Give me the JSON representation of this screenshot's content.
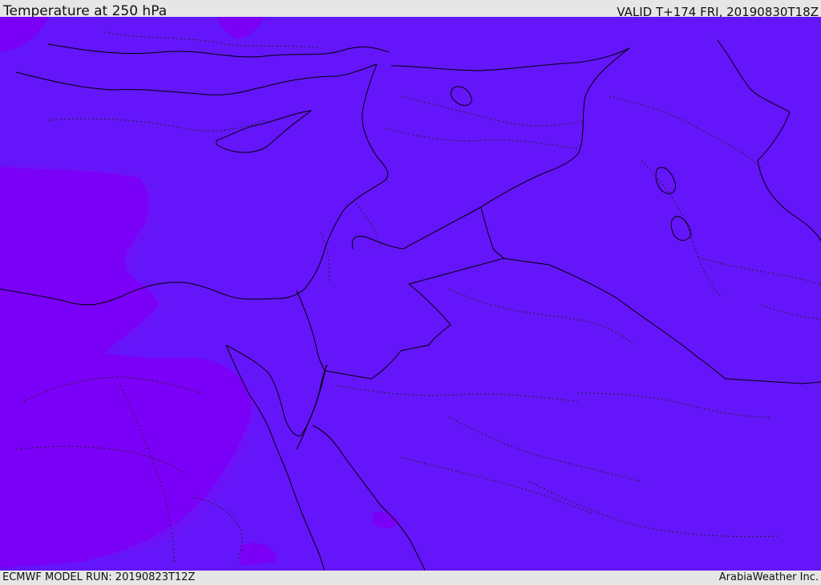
{
  "header": {
    "title": "Temperature at 250 hPa",
    "valid": "VALID T+174 FRI, 20190830T18Z"
  },
  "footer": {
    "model_run": "ECMWF MODEL RUN: 20190823T12Z",
    "credit": "ArabiaWeather Inc."
  },
  "map": {
    "field": "temperature-250hPa",
    "colors": {
      "main_field": "#6415fa",
      "warm_patch": "#7b00f8",
      "mid_patch": "#6c12f8",
      "coastline": "#000000",
      "border": "#000000"
    }
  }
}
